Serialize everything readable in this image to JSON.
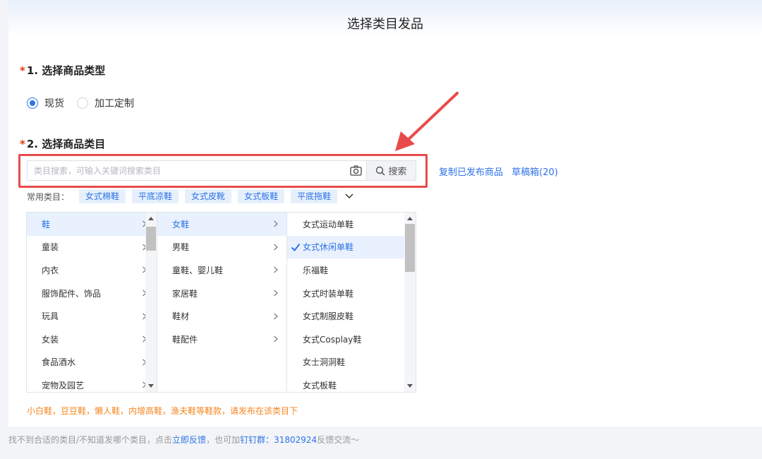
{
  "page": {
    "title": "选择类目发品"
  },
  "section1": {
    "required_mark": "*",
    "title": "1. 选择商品类型"
  },
  "product_type": {
    "options": [
      {
        "label": "现货",
        "checked": true
      },
      {
        "label": "加工定制",
        "checked": false
      }
    ]
  },
  "section2": {
    "required_mark": "*",
    "title": "2. 选择商品类目"
  },
  "search": {
    "placeholder": "类目搜索，可输入关键词搜索类目",
    "value": "",
    "button_label": "搜索",
    "camera_icon": "camera-icon",
    "search_icon": "search-icon"
  },
  "side_links": {
    "copy": "复制已发布商品",
    "drafts": "草稿箱(20)"
  },
  "common": {
    "label": "常用类目：",
    "tags": [
      "女式棉鞋",
      "平底凉鞋",
      "女式皮靴",
      "女式板鞋",
      "平底拖鞋"
    ]
  },
  "categories": {
    "level1": [
      "鞋",
      "童装",
      "内衣",
      "服饰配件、饰品",
      "玩具",
      "女装",
      "食品酒水",
      "宠物及园艺"
    ],
    "level1_active": "鞋",
    "level2": [
      "女鞋",
      "男鞋",
      "童鞋、婴儿鞋",
      "家居鞋",
      "鞋材",
      "鞋配件"
    ],
    "level2_active": "女鞋",
    "level3": [
      "女式运动单鞋",
      "女式休闲单鞋",
      "乐福鞋",
      "女式时装单鞋",
      "女式制服皮鞋",
      "女式Cosplay鞋",
      "女士洞洞鞋",
      "女式板鞋"
    ],
    "level3_selected": "女式休闲单鞋"
  },
  "hint": "小白鞋，豆豆鞋，懒人鞋，内增高鞋，渔夫鞋等鞋款，请发布在该类目下",
  "footer": {
    "text1": "找不到合适的类目/不知道发哪个类目，点击",
    "link1": "立即反馈",
    "text2": "，也可加",
    "link2": "钉钉群：31802924",
    "text3": "反馈交流～"
  },
  "colors": {
    "accent": "#2e73e8",
    "highlight_red": "#e84b4b",
    "hint_orange": "#f5861f",
    "required": "#e8380d"
  }
}
